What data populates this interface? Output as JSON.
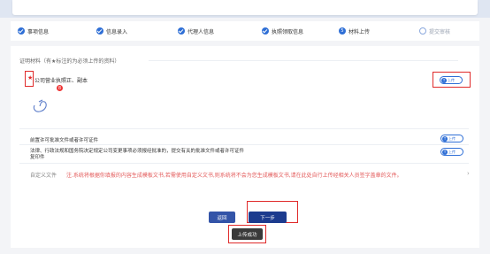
{
  "steps": [
    {
      "label": "事项信息",
      "state": "done"
    },
    {
      "label": "信息录入",
      "state": "done"
    },
    {
      "label": "代理人信息",
      "state": "done"
    },
    {
      "label": "执照领取信息",
      "state": "done"
    },
    {
      "label": "材料上传",
      "state": "current",
      "number": "5"
    },
    {
      "label": "提交审核",
      "state": "pending"
    }
  ],
  "materials": {
    "section_title": "证明材料（有★标注的为必须上传的资料）",
    "required_mark": "★",
    "items": [
      {
        "label": "公司营业执照正、副本",
        "badge": "8",
        "upload_label": "上传"
      },
      {
        "label": "前置许可批准文件或者许可证件",
        "upload_label": "上传"
      },
      {
        "label": "法律、行政法规和国务院决定规定公司变更事项必须报经批准的，提交有关的批准文件或者许可证件",
        "label_line2": "复印件",
        "upload_label": "上传"
      }
    ]
  },
  "custom_doc": {
    "label": "自定义文件",
    "note": "注.系统将根据你填报的内容生成模板文书,若需使用自定义文书,则系统将不会为您生成模板文书,请在此处自行上传经相关人员签字盖章的文件。",
    "chevron": "›"
  },
  "actions": {
    "back_label": "返回",
    "next_label": "下一步"
  },
  "toast": {
    "message": "上传成功"
  },
  "colors": {
    "accent": "#2f6fd6",
    "annotation_red": "#e02a2a",
    "button_dark": "#1c3b8e"
  }
}
